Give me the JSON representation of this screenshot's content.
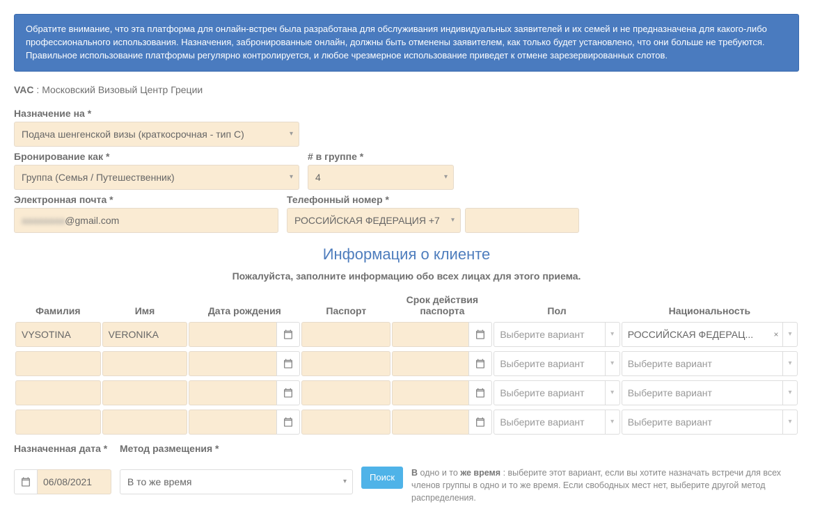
{
  "alert": "Обратите внимание, что эта платформа для онлайн-встреч была разработана для обслуживания индивидуальных заявителей и их семей и не предназначена для какого-либо профессионального использования. Назначения, забронированные онлайн, должны быть отменены заявителем, как только будет установлено, что они больше не требуются. Правильное использование платформы регулярно контролируется, и любое чрезмерное использование приведет к отмене зарезервированных слотов.",
  "vac": {
    "label": "VAC",
    "sep": ":",
    "value": "Московский Визовый Центр Греции"
  },
  "labels": {
    "appointment_for": "Назначение на *",
    "booking_as": "Бронирование как *",
    "group_count": "# в группе *",
    "email": "Электронная почта *",
    "phone": "Телефонный номер *",
    "appointed_date": "Назначенная дата *",
    "allocation_method": "Метод размещения *"
  },
  "fields": {
    "appointment_for": "Подача шенгенской визы (краткосрочная - тип C)",
    "booking_as": "Группа (Семья / Путешественник)",
    "group_count": "4",
    "email": "@gmail.com",
    "phone_country": "РОССИЙСКАЯ ФЕДЕРАЦИЯ +7",
    "phone_number": "",
    "appointed_date": "06/08/2021",
    "allocation_method": "В то же время"
  },
  "section": {
    "title": "Информация о клиенте",
    "subtitle": "Пожалуйста, заполните информацию обо всех лицах для этого приема."
  },
  "clients": {
    "headers": {
      "lastname": "Фамилия",
      "firstname": "Имя",
      "dob": "Дата рождения",
      "passport": "Паспорт",
      "passport_exp": "Срок действия паспорта",
      "gender": "Пол",
      "nationality": "Национальность"
    },
    "placeholder_select": "Выберите вариант",
    "rows": [
      {
        "lastname": "VYSOTINA",
        "firstname": "VERONIKA",
        "dob": "",
        "passport": "",
        "passport_exp": "",
        "gender": "",
        "nationality": "РОССИЙСКАЯ ФЕДЕРАЦ...",
        "nationality_clear": true
      },
      {
        "lastname": "",
        "firstname": "",
        "dob": "",
        "passport": "",
        "passport_exp": "",
        "gender": "",
        "nationality": ""
      },
      {
        "lastname": "",
        "firstname": "",
        "dob": "",
        "passport": "",
        "passport_exp": "",
        "gender": "",
        "nationality": ""
      },
      {
        "lastname": "",
        "firstname": "",
        "dob": "",
        "passport": "",
        "passport_exp": "",
        "gender": "",
        "nationality": ""
      }
    ]
  },
  "buttons": {
    "search": "Поиск"
  },
  "help": {
    "bold1": "В",
    "mid1": " одно и то ",
    "bold2": "же время",
    "rest": " : выберите этот вариант, если вы хотите назначать встречи для всех членов группы в одно и то же время. Если свободных мест нет, выберите другой метод распределения."
  }
}
